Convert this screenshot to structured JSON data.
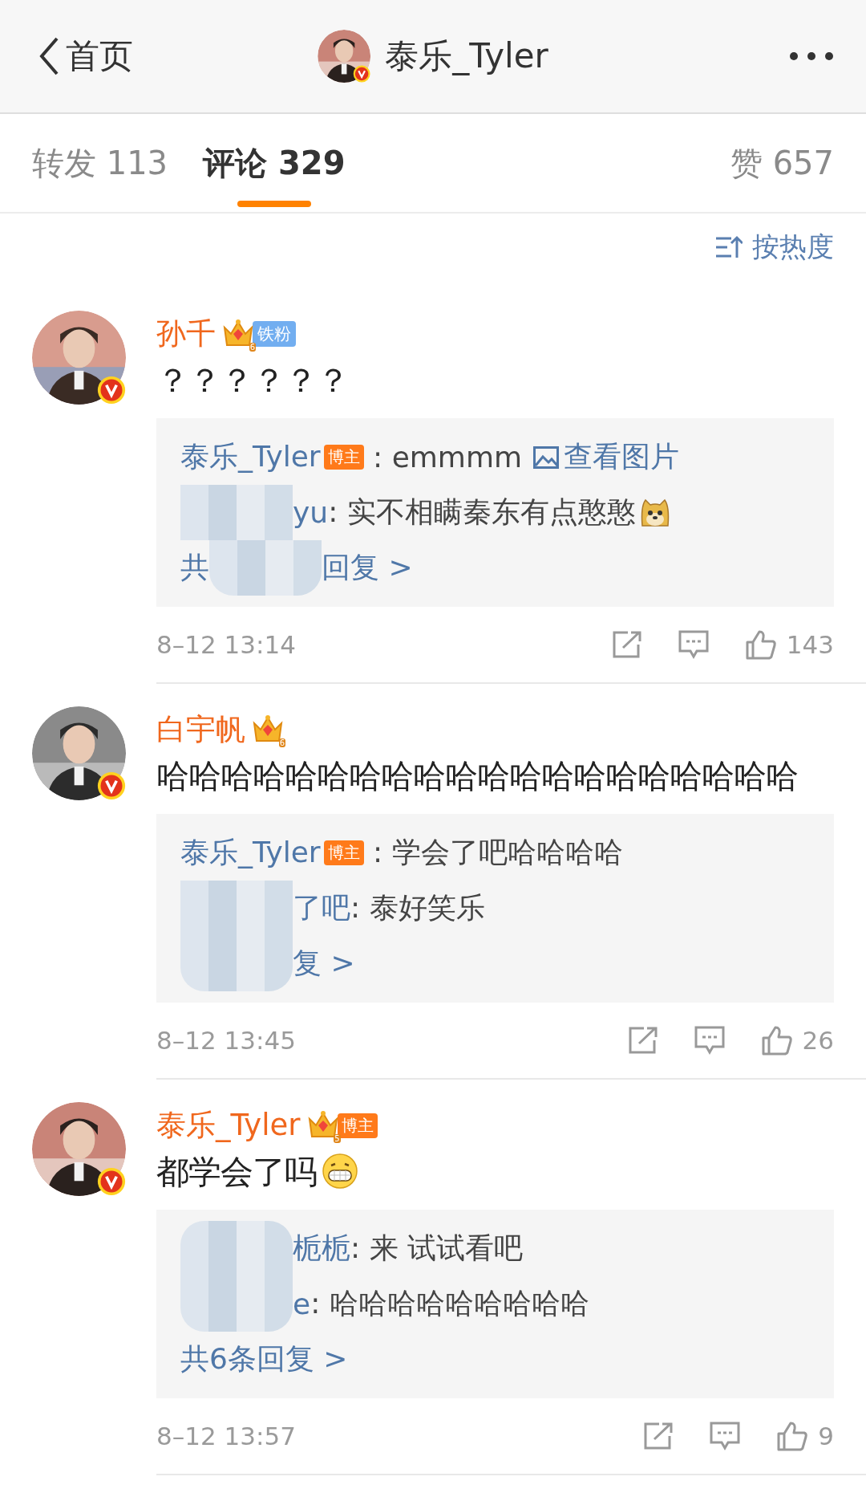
{
  "header": {
    "back_label": "首页",
    "title": "泰乐_Tyler"
  },
  "tabs": [
    {
      "label": "转发 113",
      "selected": false
    },
    {
      "label": "评论 329",
      "selected": true
    },
    {
      "label": "赞 657",
      "selected": false
    }
  ],
  "sort": {
    "label": "按热度"
  },
  "comments": [
    {
      "user": "孙千",
      "crown": "6",
      "fan_badge": "铁粉",
      "text": "？？？？？？",
      "replies": [
        {
          "user": "泰乐_Tyler",
          "tag": "博主",
          "text": " : emmmm",
          "link": "查看图片",
          "obscured": false
        },
        {
          "user": "yu",
          "text": ": 实不相瞒秦东有点憨憨",
          "emoji": {
            "kind": "doge"
          },
          "obscured": true
        }
      ],
      "more_before": "共",
      "more": "回复 >",
      "more_obscured": true,
      "time": "8–12 13:14",
      "likes": "143"
    },
    {
      "user": "白宇帆",
      "crown": "6",
      "text": "哈哈哈哈哈哈哈哈哈哈哈哈哈哈哈哈哈哈哈哈",
      "replies": [
        {
          "user": "泰乐_Tyler",
          "tag": "博主",
          "text": " : 学会了吧哈哈哈哈",
          "obscured": false
        },
        {
          "user": "了吧",
          "text": ": 泰好笑乐",
          "obscured": true
        }
      ],
      "more": "复 >",
      "more_obscured": true,
      "time": "8–12 13:45",
      "likes": "26"
    },
    {
      "user": "泰乐_Tyler",
      "crown": "5",
      "tag": "博主",
      "text": "都学会了吗",
      "emoji": {
        "kind": "grin"
      },
      "replies": [
        {
          "user": "栀栀",
          "text": ": 来 试试看吧",
          "obscured": true
        },
        {
          "user": "e",
          "text": ": 哈哈哈哈哈哈哈哈哈",
          "obscured": true
        }
      ],
      "more": "共6条回复 >",
      "more_obscured": false,
      "time": "8–12 13:57",
      "likes": "9"
    }
  ]
}
